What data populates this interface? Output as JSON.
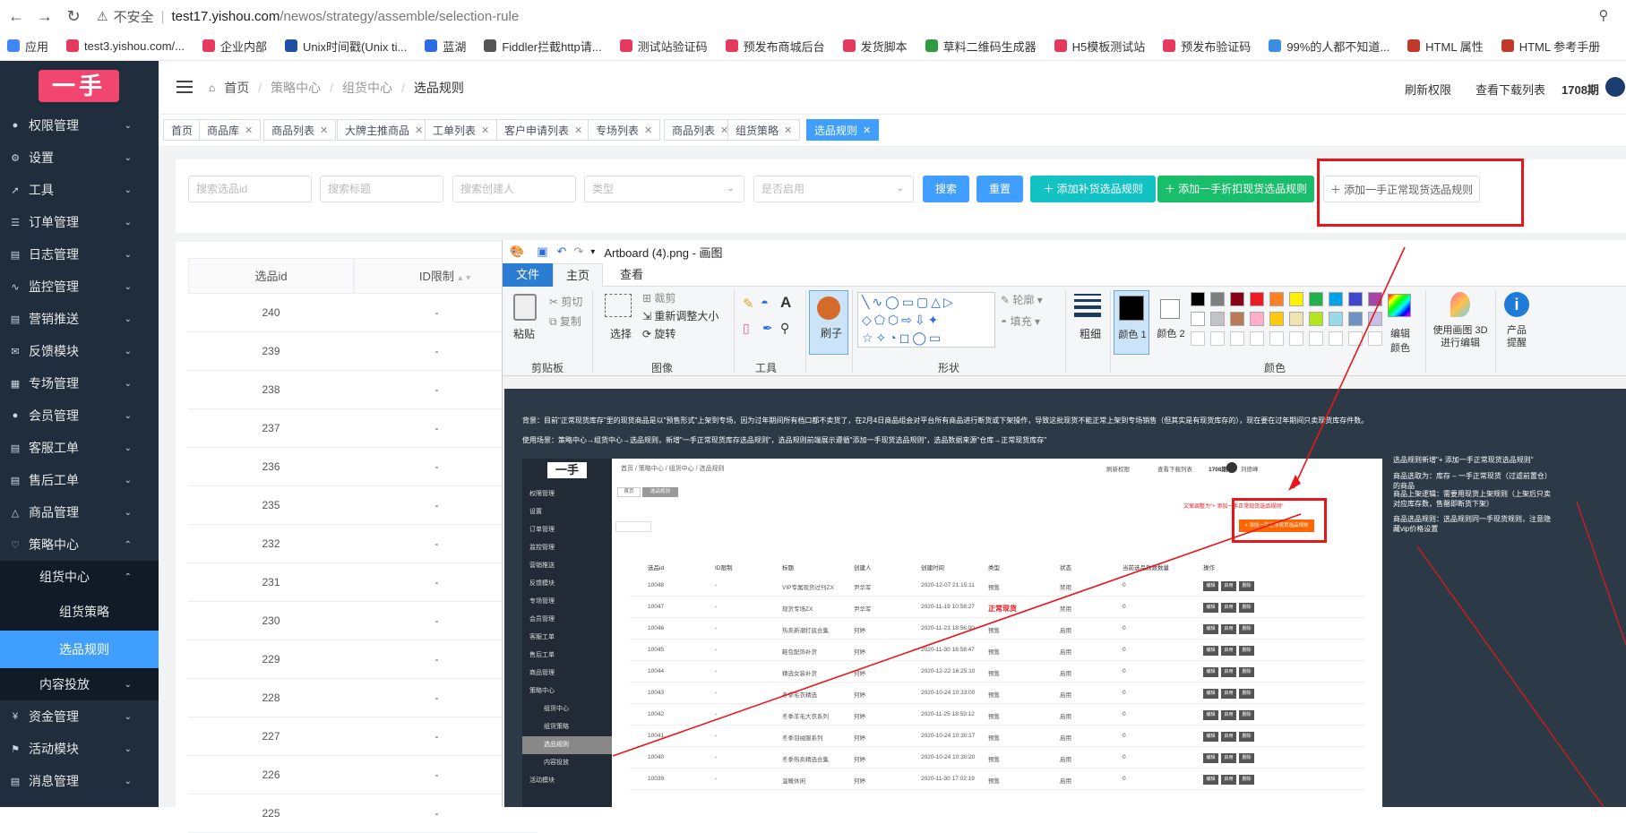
{
  "browser": {
    "security_label": "不安全",
    "url_host": "test17.yishou.com",
    "url_path": "/newos/strategy/assemble/selection-rule",
    "bookmarks": [
      {
        "label": "应用",
        "color": "#4285f4"
      },
      {
        "label": "test3.yishou.com/...",
        "color": "#e53a5e"
      },
      {
        "label": "企业内部",
        "color": "#e53a5e"
      },
      {
        "label": "Unix时间戳(Unix ti...",
        "color": "#1e4fa3"
      },
      {
        "label": "蓝湖",
        "color": "#2d6be0"
      },
      {
        "label": "Fiddler拦截http请...",
        "color": "#555555"
      },
      {
        "label": "测试站验证码",
        "color": "#e53a5e"
      },
      {
        "label": "预发布商城后台",
        "color": "#e53a5e"
      },
      {
        "label": "发货脚本",
        "color": "#e53a5e"
      },
      {
        "label": "草料二维码生成器",
        "color": "#2d9a3d"
      },
      {
        "label": "H5模板测试站",
        "color": "#e53a5e"
      },
      {
        "label": "预发布验证码",
        "color": "#e53a5e"
      },
      {
        "label": "99%的人都不知道...",
        "color": "#3a8de0"
      },
      {
        "label": "HTML 属性",
        "color": "#c0392b"
      },
      {
        "label": "HTML 参考手册",
        "color": "#c0392b"
      }
    ]
  },
  "sidebar": {
    "logo": "一手",
    "items": [
      {
        "label": "权限管理",
        "icon": "lock-icon"
      },
      {
        "label": "设置",
        "icon": "gear-icon"
      },
      {
        "label": "工具",
        "icon": "wrench-icon"
      },
      {
        "label": "订单管理",
        "icon": "list-icon"
      },
      {
        "label": "日志管理",
        "icon": "log-icon"
      },
      {
        "label": "监控管理",
        "icon": "pulse-icon"
      },
      {
        "label": "营销推送",
        "icon": "push-icon"
      },
      {
        "label": "反馈模块",
        "icon": "mail-icon"
      },
      {
        "label": "专场管理",
        "icon": "grid-icon"
      },
      {
        "label": "会员管理",
        "icon": "users-icon"
      },
      {
        "label": "客服工单",
        "icon": "ticket-icon"
      },
      {
        "label": "售后工单",
        "icon": "ticket-icon"
      },
      {
        "label": "商品管理",
        "icon": "goods-icon"
      },
      {
        "label": "策略中心",
        "icon": "strategy-icon"
      }
    ],
    "sub_group": "组货中心",
    "sub_items": [
      "组货策略",
      "选品规则"
    ],
    "content_item": "内容投放",
    "bottom_items": [
      {
        "label": "资金管理",
        "icon": "yen-icon"
      },
      {
        "label": "活动模块",
        "icon": "flag-icon"
      },
      {
        "label": "消息管理",
        "icon": "message-icon"
      }
    ]
  },
  "header": {
    "breadcrumb": [
      "首页",
      "策略中心",
      "组货中心",
      "选品规则"
    ],
    "refresh": "刷新权限",
    "downloads": "查看下载列表",
    "period": "1708期"
  },
  "tabs": [
    "首页",
    "商品库",
    "商品列表",
    "大牌主推商品",
    "工单列表",
    "客户申请列表",
    "专场列表",
    "商品列表",
    "组货策略",
    "选品规则"
  ],
  "filters": {
    "rule_id_ph": "搜索选品id",
    "title_ph": "搜索标题",
    "creator_ph": "搜索创建人",
    "type_ph": "类型",
    "enabled_ph": "是否启用",
    "search": "搜索",
    "reset": "重置",
    "add_supplement": "添加补货选品规则",
    "add_discount": "添加一手折扣现货选品规则",
    "add_normal": "添加一手正常现货选品规则"
  },
  "table": {
    "headers": [
      "选品id",
      "ID限制"
    ],
    "rows": [
      [
        "240",
        "-"
      ],
      [
        "239",
        "-"
      ],
      [
        "238",
        "-"
      ],
      [
        "237",
        "-"
      ],
      [
        "236",
        "-"
      ],
      [
        "235",
        "-"
      ],
      [
        "232",
        "-"
      ],
      [
        "231",
        "-"
      ],
      [
        "230",
        "-"
      ],
      [
        "229",
        "-"
      ],
      [
        "228",
        "-"
      ],
      [
        "227",
        "-"
      ],
      [
        "226",
        "-"
      ],
      [
        "225",
        "-"
      ]
    ]
  },
  "paint": {
    "title": "Artboard (4).png - 画图",
    "menu": [
      "文件",
      "主页",
      "查看"
    ],
    "groups": [
      "剪贴板",
      "图像",
      "工具",
      "形状",
      "颜色"
    ],
    "clipboard": {
      "paste": "粘贴",
      "cut": "剪切",
      "copy": "复制"
    },
    "image": {
      "select": "选择",
      "crop": "裁剪",
      "resize": "重新调整大小",
      "rotate": "旋转"
    },
    "brush": "刷子",
    "outline": "轮廓",
    "fill": "填充",
    "size": "粗细",
    "color1": "颜色 1",
    "color2": "颜色 2",
    "edit_colors": "编辑颜色",
    "paint3d": "使用画图 3D 进行编辑",
    "product_alert": "产品提醒",
    "palette": [
      "#000000",
      "#7f7f7f",
      "#880015",
      "#ed1c24",
      "#ff7f27",
      "#fff200",
      "#22b14c",
      "#00a2e8",
      "#3f48cc",
      "#a349a4",
      "#ffffff",
      "#c3c3c3",
      "#b97a57",
      "#ffaec9",
      "#ffc90e",
      "#efe4b0",
      "#b5e61d",
      "#99d9ea",
      "#7092be",
      "#c8bfe7"
    ]
  },
  "canvas": {
    "background_text": "背景：目前\"正常现货库存\"里的现货商品是以\"预售形式\"上架到专场，因为过年期间所有档口都不卖货了，在2月4日商品组会对平台所有商品进行断货或下架操作，导致这批现货不能正常上架到专场销售（但其实是有现货库存的），现在要在过年期间只卖现货库存件数。",
    "usage_text": "使用场景：策略中心→组货中心→选品规则，新增\"一手正常现货库存选品规则\"，选品规则前端展示遵循\"添加一手现货选品规则\"，选品数据来源\"仓库→正常现货库存\"",
    "inner_logo": "一手",
    "inner_crumbs": "首页 / 策略中心 / 组货中心 / 选品规则",
    "inner_tab": "选品规则",
    "inner_refresh": "刷新权限",
    "inner_downloads": "查看下载列表",
    "inner_period": "1708期",
    "inner_user": "刘德峰",
    "annotation": "文案调整为\"+ 添加一手正常现货选品规则\"",
    "inner_add_btn": "+ 添加一手正常现货选品规则",
    "inner_sidebar": [
      "权限管理",
      "设置",
      "订单管理",
      "监控管理",
      "营销推送",
      "反馈模块",
      "专场管理",
      "会员管理",
      "客服工单",
      "售后工单",
      "商品管理",
      "策略中心",
      "组货中心",
      "组货策略",
      "选品规则",
      "内容投放",
      "活动模块"
    ],
    "inner_headers": [
      "选品id",
      "ID限制",
      "标题",
      "创建人",
      "创建时间",
      "类型",
      "状态",
      "当前选品款数数量",
      "操作"
    ],
    "inner_rows": [
      [
        "10048",
        "-",
        "VIP专属现货过刊ZX",
        "尹华军",
        "2020-12-07 21:15:11",
        "预售",
        "禁用",
        "0"
      ],
      [
        "10047",
        "-",
        "现货专场ZX",
        "尹华军",
        "2020-11-19 10:58:27",
        "正常现货",
        "禁用",
        "0"
      ],
      [
        "10046",
        "-",
        "热卖新潮打底合集",
        "何婷",
        "2020-11-23 18:56:00",
        "预售",
        "启用",
        "0"
      ],
      [
        "10045",
        "-",
        "鞋包配饰补货",
        "何婷",
        "2020-11-30 16:58:47",
        "预售",
        "启用",
        "0"
      ],
      [
        "10044",
        "-",
        "精选女装补货",
        "何婷",
        "2020-12-22 16:25:10",
        "预售",
        "启用",
        "0"
      ],
      [
        "10043",
        "-",
        "冬季毛衣精选",
        "何婷",
        "2020-10-24 10:33:00",
        "预售",
        "启用",
        "0"
      ],
      [
        "10042",
        "-",
        "冬季羊毛大衣系列",
        "何婷",
        "2020-11-25 18:59:12",
        "预售",
        "启用",
        "0"
      ],
      [
        "10041",
        "-",
        "冬季羽绒服系列",
        "何婷",
        "2020-10-24 10:30:17",
        "预售",
        "启用",
        "0"
      ],
      [
        "10040",
        "-",
        "冬季热卖精选合集",
        "何婷",
        "2020-10-24 10:30:20",
        "预售",
        "启用",
        "0"
      ],
      [
        "10039",
        "-",
        "温暖休闲",
        "何婷",
        "2020-11-30 17:02:19",
        "预售",
        "启用",
        "0"
      ]
    ],
    "inner_actions": [
      "编辑",
      "启用",
      "删除"
    ],
    "notes": [
      "选品规则新增\"+ 添加一手正常现货选品规则\"",
      "商品选取为：库存 – 一手正常现货（过滤前置仓）的商品",
      "商品上架逻辑：需要用现货上架规则（上架后只卖对应库存数，售罄即断货下架）",
      "商品选品规则：选品规则同一手现货规则，注意隐藏vip价格设置"
    ]
  },
  "colors": {
    "sidebar": "#1f2d3d",
    "accent": "#409eff",
    "cyan": "#13c2c2",
    "green": "#19be6b",
    "orange": "#ff6600",
    "red_annotation": "#e8161b",
    "logo": "#f24671"
  }
}
